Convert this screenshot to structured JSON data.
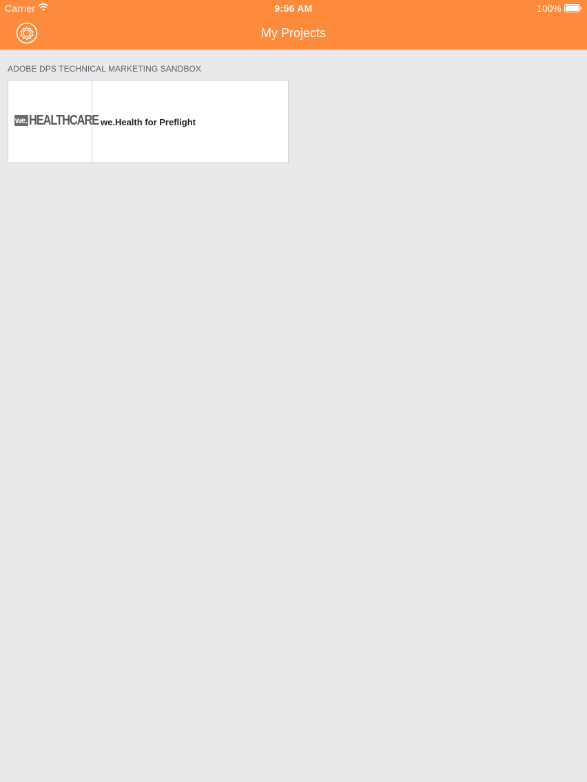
{
  "status_bar": {
    "carrier": "Carrier",
    "time": "9:56 AM",
    "battery": "100%"
  },
  "navbar": {
    "title": "My Projects",
    "settings_icon": "gear-icon"
  },
  "section": {
    "header": "ADOBE DPS TECHNICAL MARKETING SANDBOX"
  },
  "projects": [
    {
      "logo_prefix": "we.",
      "logo_brand": "HEALTHCARE",
      "title": "we.Health for Preflight"
    }
  ],
  "colors": {
    "accent": "#fe8a3c",
    "background": "#e9e8ea"
  }
}
